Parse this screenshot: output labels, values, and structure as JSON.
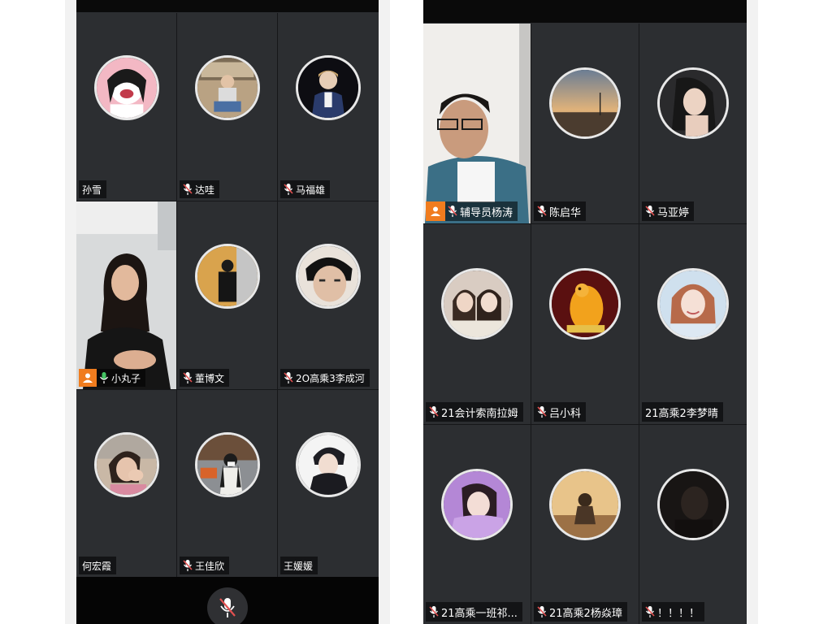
{
  "colors": {
    "speaking_border": "#3cb371",
    "host_badge": "#f07c1e",
    "muted_mic": "#e35050",
    "active_mic": "#45c464"
  },
  "left_phone": {
    "participants": [
      {
        "name": "孙雪",
        "mic": "none",
        "avatar": "cartoon-girl-avatar"
      },
      {
        "name": "达哇",
        "mic": "muted",
        "avatar": "photo-avatar-seated-boy"
      },
      {
        "name": "马福雄",
        "mic": "muted",
        "avatar": "photo-avatar-young-man"
      },
      {
        "name": "小丸子",
        "mic": "active",
        "host": true,
        "video": "woman-video-feed"
      },
      {
        "name": "董博文",
        "mic": "muted",
        "avatar": "photo-avatar-black-jacket"
      },
      {
        "name": "2O高乘3李成河",
        "mic": "muted",
        "avatar": "photo-avatar-boy-face"
      },
      {
        "name": "何宏霞",
        "mic": "none",
        "avatar": "photo-avatar-girl-hand"
      },
      {
        "name": "王佳欣",
        "mic": "muted",
        "avatar": "photo-avatar-street-girl"
      },
      {
        "name": "王媛媛",
        "mic": "none",
        "avatar": "anime-boy-avatar"
      }
    ]
  },
  "right_phone": {
    "participants": [
      {
        "name": "辅导员杨涛",
        "mic": "muted",
        "host": true,
        "video": "man-glasses-video-feed"
      },
      {
        "name": "陈启华",
        "mic": "muted",
        "avatar": "sunset-avatar"
      },
      {
        "name": "马亚婷",
        "mic": "muted",
        "avatar": "photo-avatar-long-hair"
      },
      {
        "name": "21会计索南拉姆",
        "mic": "muted",
        "avatar": "photo-avatar-two-girls"
      },
      {
        "name": "吕小科",
        "mic": "muted",
        "avatar": "orange-figure-avatar"
      },
      {
        "name": "21高乘2李梦晴",
        "mic": "none",
        "avatar": "photo-avatar-smiling-girl"
      },
      {
        "name": "21高乘一班祁...",
        "mic": "muted",
        "avatar": "photo-avatar-purple-girl"
      },
      {
        "name": "21高乘2杨焱璋",
        "mic": "muted",
        "avatar": "photo-avatar-warm-boy"
      },
      {
        "name": "！！！！",
        "mic": "muted",
        "avatar": "dark-avatar"
      }
    ]
  },
  "controls": {
    "mic_button": "muted-mic-icon"
  }
}
